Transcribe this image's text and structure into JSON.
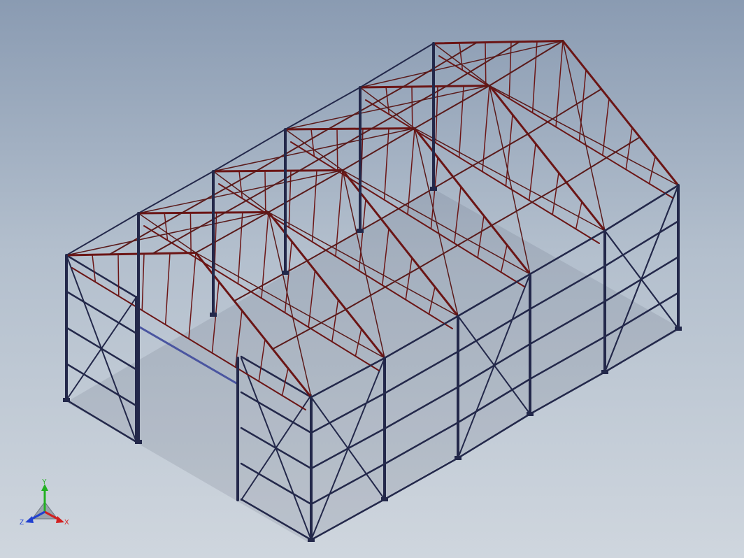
{
  "viewport": {
    "background_top": "#8a9bb2",
    "background_bottom": "#cfd6de"
  },
  "model": {
    "type": "steel-frame-building",
    "column_color": "#23284a",
    "truss_color": "#6b1515",
    "beam_color": "#5a1a1a",
    "door_beam_color": "#4a55a0"
  },
  "triad": {
    "x_label": "X",
    "y_label": "Y",
    "z_label": "Z",
    "x_color": "#d22020",
    "y_color": "#22b022",
    "z_color": "#2040d0"
  }
}
